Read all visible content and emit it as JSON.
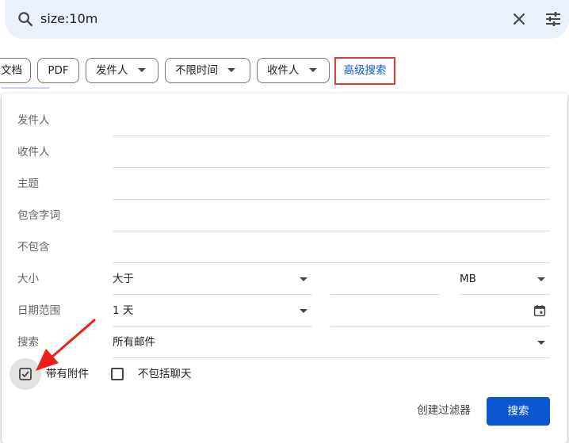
{
  "search": {
    "query": "size:10m",
    "icons": [
      "search-icon",
      "close-icon",
      "tune-icon"
    ]
  },
  "chips": {
    "docs": "文档",
    "pdf": "PDF",
    "from": "发件人",
    "time": "不限时间",
    "to": "收件人",
    "advanced": "高级搜索"
  },
  "panel": {
    "labels": {
      "from": "发件人",
      "to": "收件人",
      "subject": "主题",
      "has_words": "包含字词",
      "doesnt_have": "不包含",
      "size": "大小",
      "date_range": "日期范围",
      "search_in": "搜索"
    },
    "size_op": "大于",
    "size_unit": "MB",
    "date_value": "1 天",
    "search_scope": "所有邮件",
    "has_attachment": "带有附件",
    "has_attachment_checked": true,
    "exclude_chats": "不包括聊天",
    "exclude_chats_checked": false,
    "create_filter": "创建过滤器",
    "search_button": "搜索"
  },
  "colors": {
    "accent": "#0b57d0",
    "highlight_box": "#e53935",
    "arrow": "#e8201a",
    "searchbar_bg": "#eaf1fb"
  }
}
